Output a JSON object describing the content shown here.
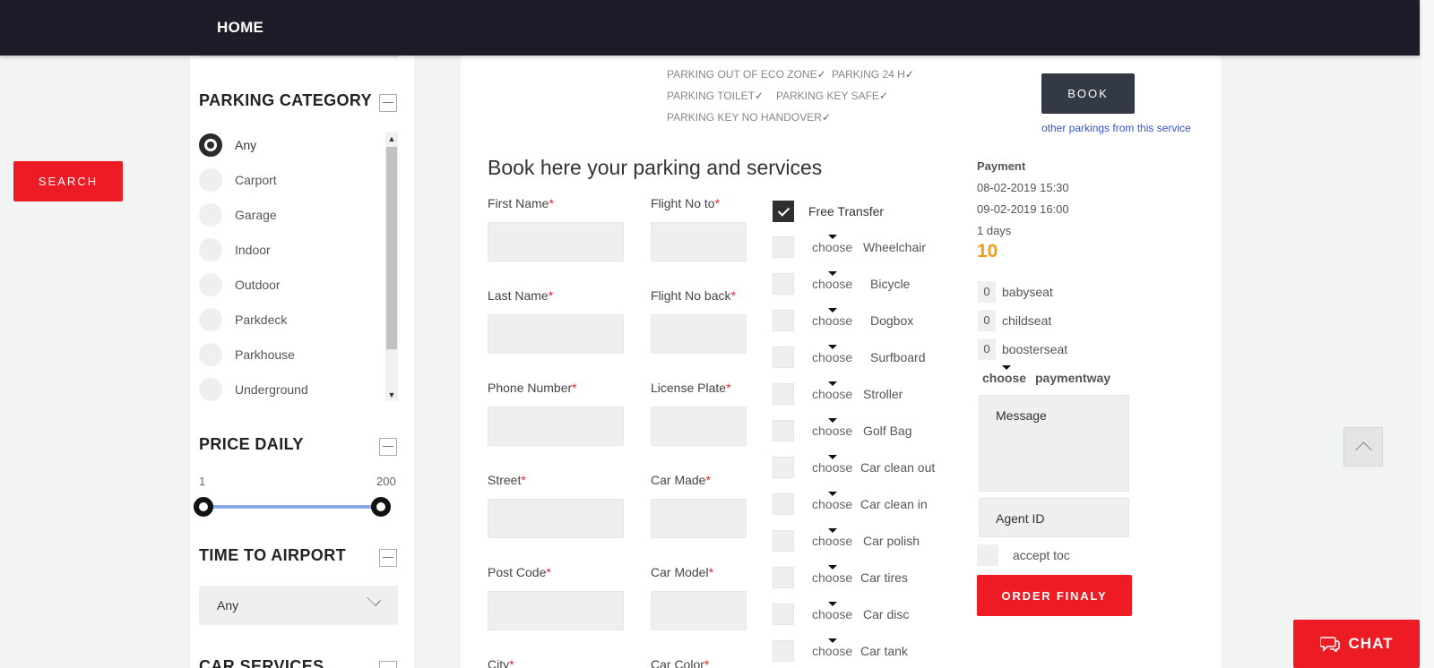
{
  "nav": {
    "home": "HOME"
  },
  "left": {
    "search_button": "SEARCH"
  },
  "sidebar": {
    "parking_category": {
      "title": "PARKING CATEGORY",
      "options": [
        "Any",
        "Carport",
        "Garage",
        "Indoor",
        "Outdoor",
        "Parkdeck",
        "Parkhouse",
        "Underground"
      ],
      "selected": "Any"
    },
    "price_daily": {
      "title": "PRICE DAILY",
      "min": "1",
      "max": "200"
    },
    "time_to_airport": {
      "title": "TIME TO AIRPORT",
      "value": "Any"
    },
    "car_services": {
      "title": "CAR SERVICES"
    }
  },
  "listing": {
    "features": [
      "PARKING OUT OF ECO ZONE",
      "PARKING 24 H",
      "PARKING TOILET",
      "PARKING KEY SAFE",
      "PARKING KEY NO HANDOVER"
    ],
    "book_button": "BOOK",
    "other_link": "other parkings from this service"
  },
  "form": {
    "title": "Book here your parking and services",
    "fields_left": [
      "First Name",
      "Last Name",
      "Phone Number",
      "Street",
      "Post Code",
      "City"
    ],
    "fields_right": [
      "Flight No to",
      "Flight No back",
      "License Plate",
      "Car Made",
      "Car Model",
      "Car Color"
    ],
    "required_mark": "*",
    "free_transfer": "Free Transfer",
    "choose_label": "choose",
    "services": [
      "Wheelchair",
      "Bicycle",
      "Dogbox",
      "Surfboard",
      "Stroller",
      "Golf Bag",
      "Car clean out",
      "Car clean in",
      "Car polish",
      "Car tires",
      "Car disc",
      "Car tank"
    ]
  },
  "payment": {
    "label": "Payment",
    "start": "08-02-2019 15:30",
    "end": "09-02-2019 16:00",
    "duration": "1 days",
    "price": "10",
    "seats": [
      {
        "qty": "0",
        "label": "babyseat"
      },
      {
        "qty": "0",
        "label": "childseat"
      },
      {
        "qty": "0",
        "label": "boosterseat"
      }
    ],
    "paymentway_choose": "choose",
    "paymentway_label": "paymentway",
    "message_placeholder": "Message",
    "agent_placeholder": "Agent ID",
    "accept_toc": "accept toc",
    "order_button": "ORDER FINALY"
  },
  "widgets": {
    "chat": "CHAT"
  },
  "colors": {
    "accent_red": "#ed1c24",
    "nav_dark": "#1d1c28",
    "price_orange": "#f39c12",
    "link_blue": "#3556c9"
  }
}
